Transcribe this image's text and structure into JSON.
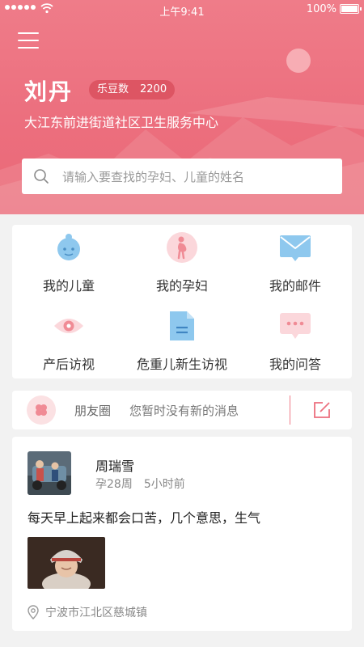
{
  "status_bar": {
    "time": "上午9:41",
    "battery": "100%"
  },
  "profile": {
    "name": "刘丹",
    "points_label": "乐豆数",
    "points_value": "2200",
    "organization": "大江东前进街道社区卫生服务中心"
  },
  "search": {
    "placeholder": "请输入要查找的孕妇、儿童的姓名"
  },
  "features": [
    {
      "label": "我的儿童",
      "icon": "baby-icon"
    },
    {
      "label": "我的孕妇",
      "icon": "pregnant-icon"
    },
    {
      "label": "我的邮件",
      "icon": "mail-icon"
    },
    {
      "label": "产后访视",
      "icon": "eye-icon"
    },
    {
      "label": "危重儿新生访视",
      "icon": "document-icon"
    },
    {
      "label": "我的问答",
      "icon": "chat-icon"
    }
  ],
  "moments": {
    "label": "朋友圈",
    "status": "您暂时没有新的消息"
  },
  "post": {
    "author": "周瑞雪",
    "pregnancy_week": "孕28周",
    "time_ago": "5小时前",
    "content": "每天早上起来都会口苦，几个意思，生气",
    "location": "宁波市江北区慈城镇"
  },
  "colors": {
    "accent": "#ec6f7e",
    "badge": "#dd5563",
    "icon_blue": "#8ec8ee",
    "icon_pink": "#f08b95"
  }
}
